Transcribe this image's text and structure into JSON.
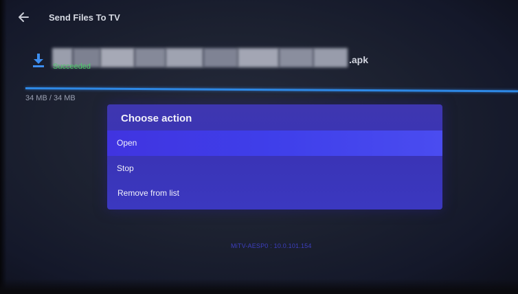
{
  "header": {
    "title": "Send Files To TV",
    "back_icon": "arrow-left-icon"
  },
  "transfer": {
    "file_icon": "download-icon",
    "file_extension": ".apk",
    "status": "Succeeded",
    "progress_fraction": 1.0,
    "size_label": "34 MB / 34 MB"
  },
  "dialog": {
    "title": "Choose action",
    "items": [
      {
        "label": "Open",
        "selected": true
      },
      {
        "label": "Stop",
        "selected": false
      },
      {
        "label": "Remove from list",
        "selected": false
      }
    ]
  },
  "footer": {
    "device_info": "MiTV-AESP0 : 10.0.101.154"
  },
  "colors": {
    "accent_blue": "#2e89e6",
    "success_green": "#4ccf6a",
    "dialog_bg": "#3a34b6",
    "dialog_selected": "#4034e0"
  }
}
